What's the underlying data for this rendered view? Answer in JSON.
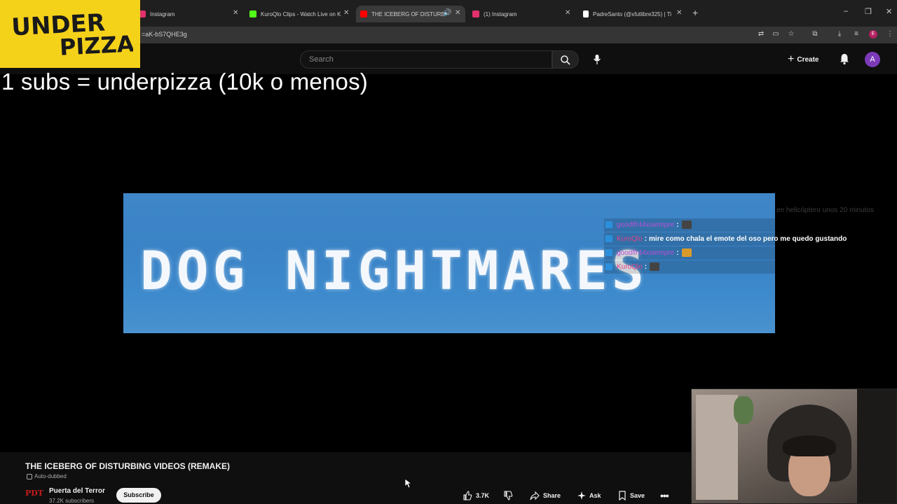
{
  "browser": {
    "tabs": [
      {
        "title": "Instagram",
        "favicon_color": "#e1306c"
      },
      {
        "title": "KuroQlo Clips - Watch Live on K",
        "favicon_color": "#53fc18"
      },
      {
        "title": "THE ICEBERG OF DISTURBI",
        "favicon_color": "#ff0000"
      },
      {
        "title": "(1) Instagram",
        "favicon_color": "#e1306c"
      },
      {
        "title": "PadreSanto (@xfutlibre325) | Ti",
        "favicon_color": "#ffffff"
      }
    ],
    "new_tab": "+",
    "url": "=aK-bS7QHE3g",
    "profile_initial": "E"
  },
  "youtube": {
    "search_placeholder": "Search",
    "create_label": "Create",
    "avatar_initial": "A"
  },
  "overlay": {
    "logo_line1": "UNDER",
    "logo_line2": "PIZZA",
    "subtitle": "1 subs = underpizza (10k o menos)"
  },
  "video": {
    "frame_text": "DOG NIGHTMARES",
    "faded_note": "en helicóptero unos 20 minutos"
  },
  "chat": [
    {
      "user": "goodlfr44xsiempre",
      "user_color": "#b84fd6",
      "message": "",
      "emote": true
    },
    {
      "user": "KuroQlo",
      "user_color": "#e0428a",
      "message": "mire como chala el emote del oso pero me quedo gustando",
      "emote": false
    },
    {
      "user": "goodlfr44xsiempre",
      "user_color": "#b84fd6",
      "message": "",
      "emote": true
    },
    {
      "user": "KuroQlo",
      "user_color": "#e0428a",
      "message": "",
      "emote": true
    }
  ],
  "info": {
    "title": "THE ICEBERG OF DISTURBING VIDEOS (REMAKE)",
    "auto_dubbed": "Auto-dubbed",
    "channel_logo": "PDT",
    "channel_name": "Puerta del Terror",
    "subscribers": "37.2K subscribers",
    "subscribe_label": "Subscribe",
    "likes": "3.7K",
    "share_label": "Share",
    "ask_label": "Ask",
    "save_label": "Save"
  }
}
